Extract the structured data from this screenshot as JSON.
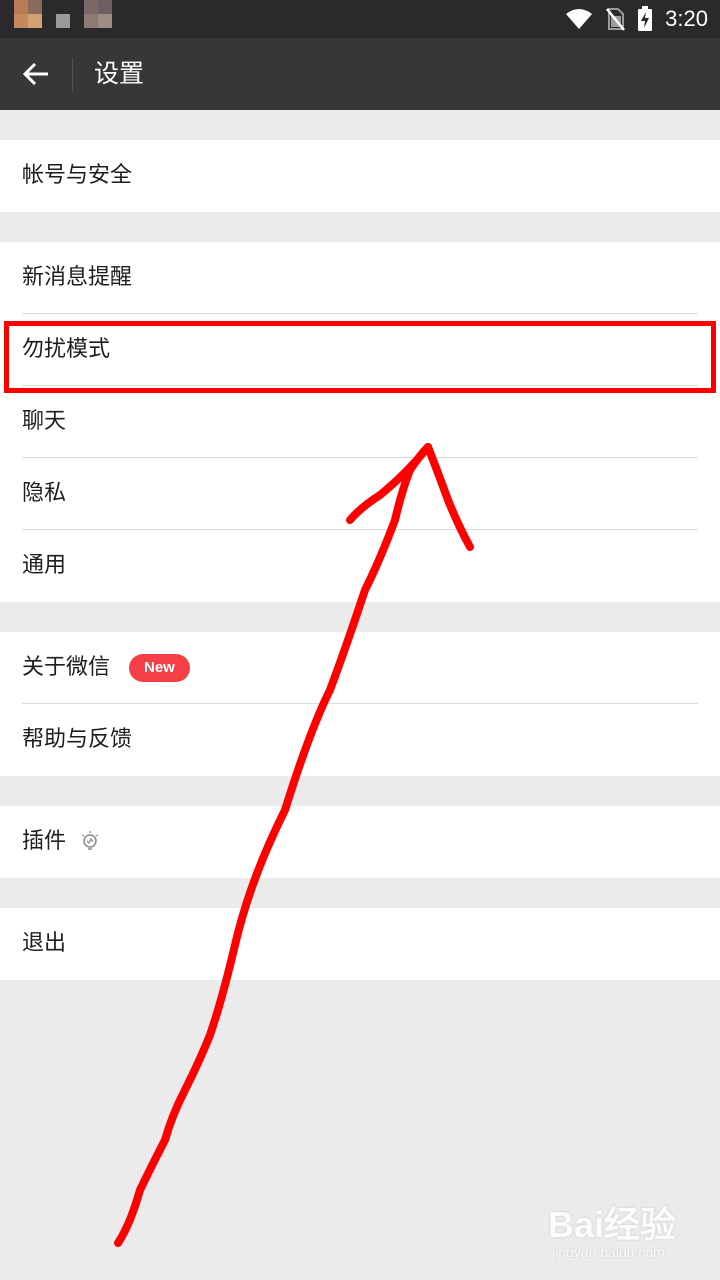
{
  "status_bar": {
    "time": "3:20"
  },
  "title_bar": {
    "title": "设置"
  },
  "groups": [
    {
      "items": [
        {
          "label": "帐号与安全"
        }
      ]
    },
    {
      "items": [
        {
          "label": "新消息提醒"
        },
        {
          "label": "勿扰模式"
        },
        {
          "label": "聊天"
        },
        {
          "label": "隐私"
        },
        {
          "label": "通用"
        }
      ]
    },
    {
      "items": [
        {
          "label": "关于微信",
          "badge": "New"
        },
        {
          "label": "帮助与反馈"
        }
      ]
    },
    {
      "items": [
        {
          "label": "插件",
          "icon": "lightbulb-icon"
        }
      ]
    },
    {
      "items": [
        {
          "label": "退出"
        }
      ]
    }
  ],
  "annotation": {
    "highlighted_item": "勿扰模式",
    "highlight_color": "#ff0000",
    "arrow_color": "#ff0000"
  },
  "watermark": {
    "logo": "Bai经验",
    "url": "jingyan.baidu.com"
  },
  "colors": {
    "status_bar": "#2a2a2c",
    "title_bar": "#37373a",
    "background": "#ebebeb",
    "badge": "#f43f46"
  }
}
